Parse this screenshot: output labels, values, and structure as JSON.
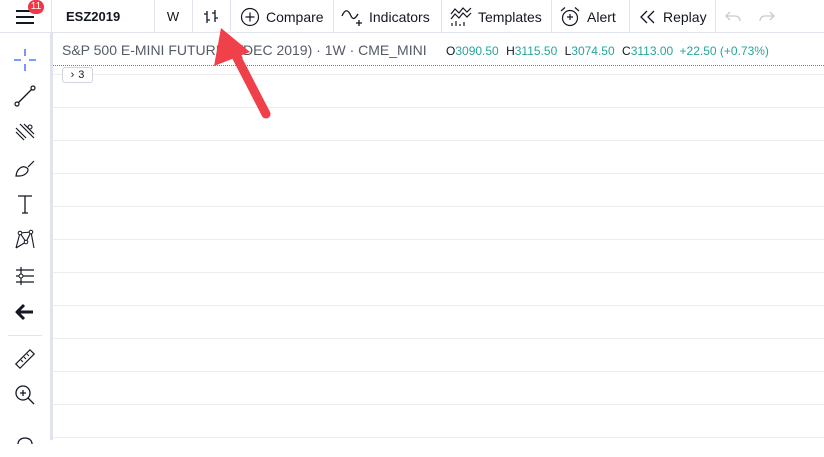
{
  "toolbar": {
    "badge_count": "11",
    "symbol": "ESZ2019",
    "interval": "W",
    "compare_label": "Compare",
    "indicators_label": "Indicators",
    "templates_label": "Templates",
    "alert_label": "Alert",
    "replay_label": "Replay"
  },
  "legend": {
    "title": "S&P 500 E-MINI FUTURES (DEC 2019) · 1W · CME_MINI",
    "open_label": "O",
    "open": "3090.50",
    "high_label": "H",
    "high": "3115.50",
    "low_label": "L",
    "low": "3074.50",
    "close_label": "C",
    "close": "3113.00",
    "change": "+22.50 (+0.73%)",
    "collapse_count": "3"
  },
  "colors": {
    "accent_red": "#f23645",
    "up_green": "#26a69a",
    "annotation_arrow": "#f0404a"
  },
  "icons": {
    "sidebar": [
      "crosshair-icon",
      "trend-line-icon",
      "fib-icon",
      "brush-icon",
      "text-icon",
      "pattern-icon",
      "prediction-icon",
      "back-arrow-icon",
      "ruler-icon",
      "zoom-in-icon"
    ]
  }
}
